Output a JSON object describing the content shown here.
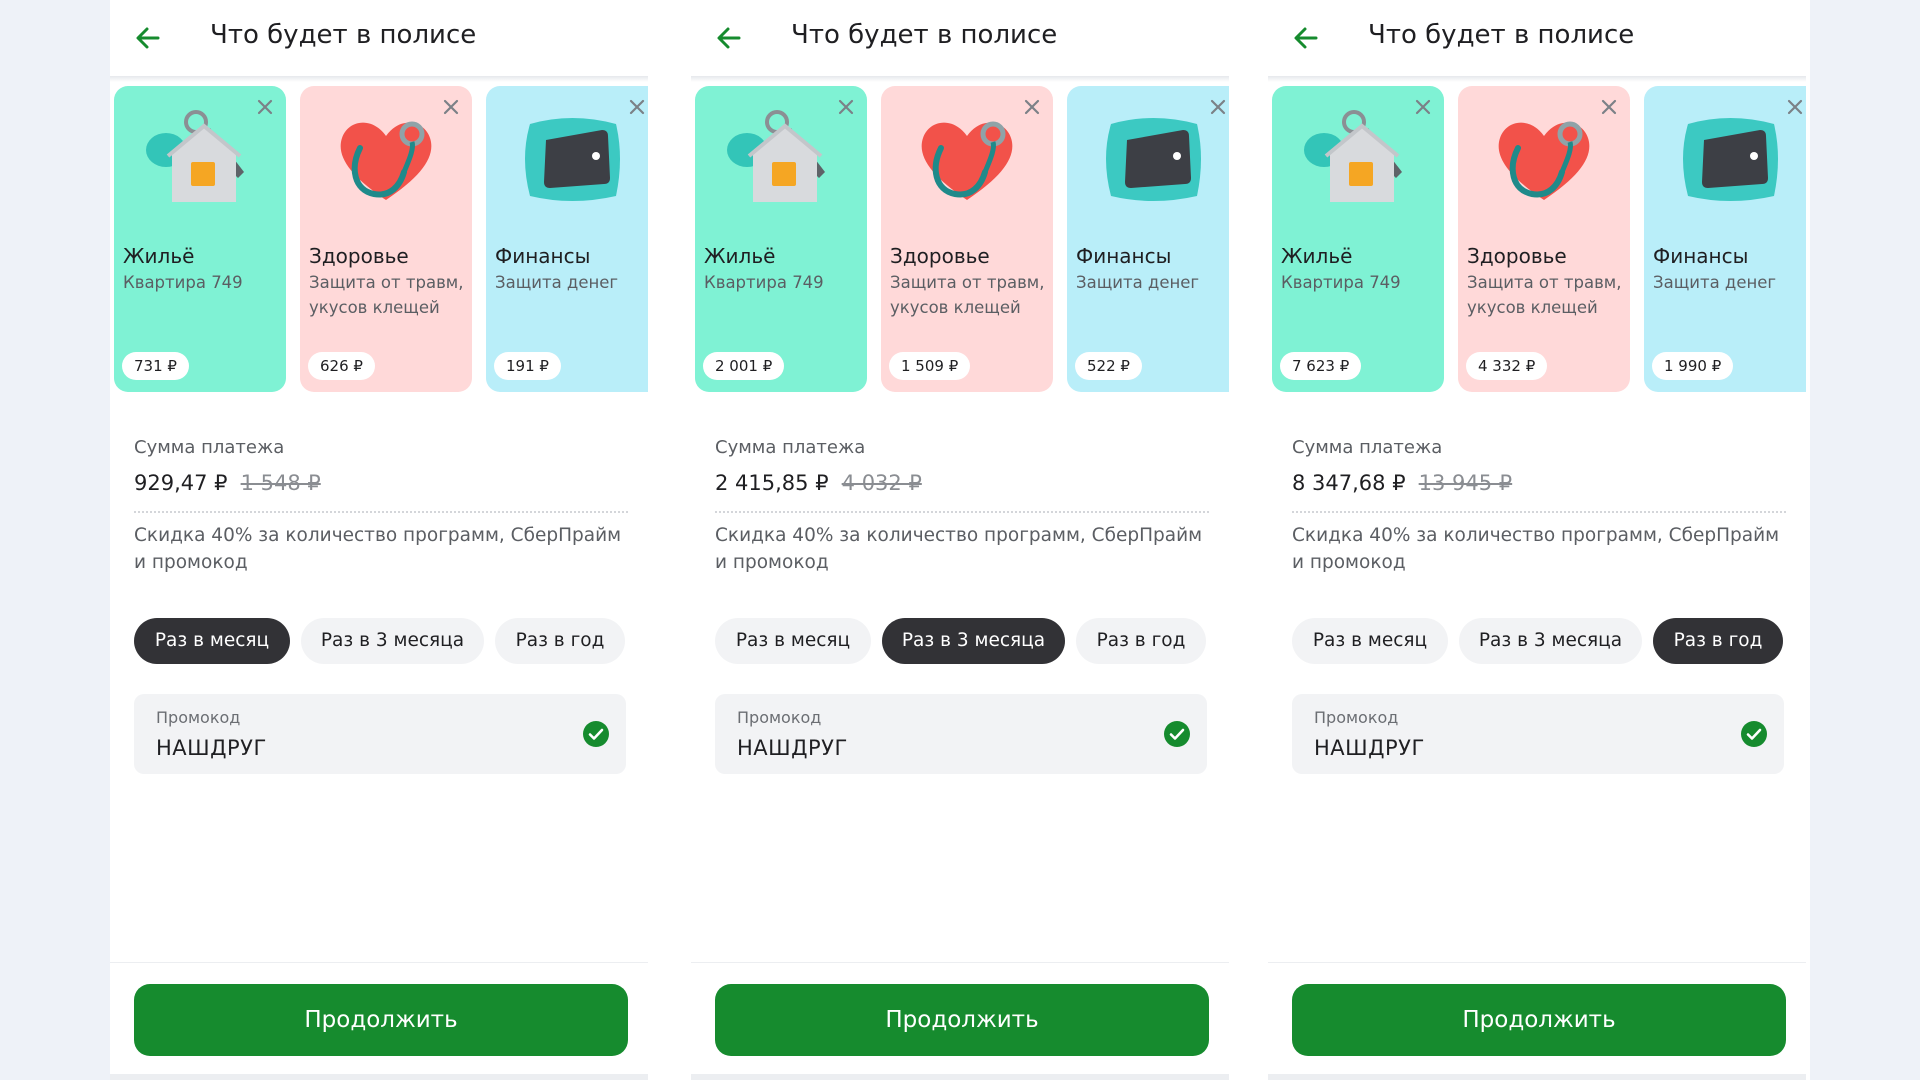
{
  "colors": {
    "accent": "#168b2e",
    "background": "#eef2f8",
    "card_housing": "#7ff2d4",
    "card_health": "#ffd9d9",
    "card_finance": "#b9eef9",
    "pill_active": "#323236",
    "pill_inactive": "#f2f3f5"
  },
  "icons": {
    "back": "arrow-left-icon",
    "close": "close-icon",
    "check": "check-circle-icon",
    "housing": "house-keys-icon",
    "health": "heart-stethoscope-icon",
    "finance": "wallet-pillow-icon"
  },
  "screens": [
    {
      "title": "Что будет в полисе",
      "cards": [
        {
          "name": "Жильё",
          "desc": "Квартира 749",
          "price": "731 ₽"
        },
        {
          "name": "Здоровье",
          "desc": "Защита от травм, укусов клещей",
          "price": "626 ₽"
        },
        {
          "name": "Финансы",
          "desc": "Защита денег",
          "price": "191 ₽"
        }
      ],
      "payment_label": "Сумма платежа",
      "payment_amount": "929,47 ₽",
      "payment_old": "1 548 ₽",
      "discount": "Скидка 40% за количество программ, СберПрайм и промокод",
      "periods": [
        "Раз в месяц",
        "Раз в 3 месяца",
        "Раз в год"
      ],
      "selected_period": "Раз в месяц",
      "promo_label": "Промокод",
      "promo_value": "НАШДРУГ",
      "continue_label": "Продолжить"
    },
    {
      "title": "Что будет в полисе",
      "cards": [
        {
          "name": "Жильё",
          "desc": "Квартира 749",
          "price": "2 001 ₽"
        },
        {
          "name": "Здоровье",
          "desc": "Защита от травм, укусов клещей",
          "price": "1 509 ₽"
        },
        {
          "name": "Финансы",
          "desc": "Защита денег",
          "price": "522 ₽"
        }
      ],
      "payment_label": "Сумма платежа",
      "payment_amount": "2 415,85 ₽",
      "payment_old": "4 032 ₽",
      "discount": "Скидка 40% за количество программ, СберПрайм и промокод",
      "periods": [
        "Раз в месяц",
        "Раз в 3 месяца",
        "Раз в год"
      ],
      "selected_period": "Раз в 3 месяца",
      "promo_label": "Промокод",
      "promo_value": "НАШДРУГ",
      "continue_label": "Продолжить"
    },
    {
      "title": "Что будет в полисе",
      "cards": [
        {
          "name": "Жильё",
          "desc": "Квартира 749",
          "price": "7 623 ₽"
        },
        {
          "name": "Здоровье",
          "desc": "Защита от травм, укусов клещей",
          "price": "4 332 ₽"
        },
        {
          "name": "Финансы",
          "desc": "Защита денег",
          "price": "1 990 ₽"
        }
      ],
      "payment_label": "Сумма платежа",
      "payment_amount": "8 347,68 ₽",
      "payment_old": "13 945 ₽",
      "discount": "Скидка 40% за количество программ, СберПрайм и промокод",
      "periods": [
        "Раз в месяц",
        "Раз в 3 месяца",
        "Раз в год"
      ],
      "selected_period": "Раз в год",
      "promo_label": "Промокод",
      "promo_value": "НАШДРУГ",
      "continue_label": "Продолжить"
    }
  ]
}
